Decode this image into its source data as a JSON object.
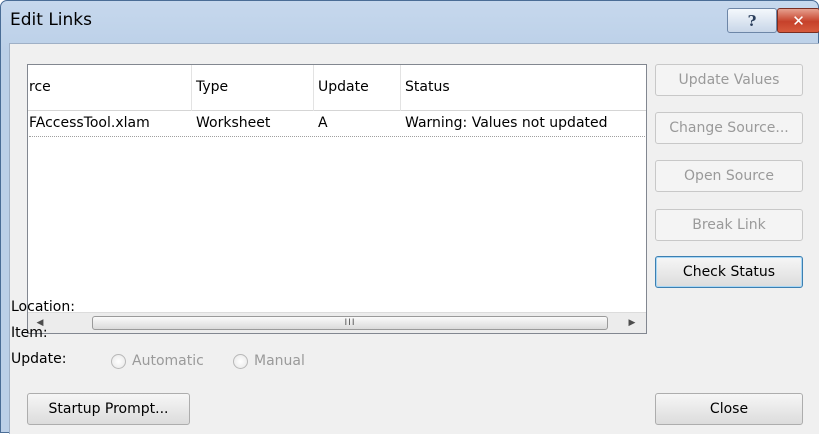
{
  "window": {
    "title": "Edit Links",
    "help_label": "?",
    "close_glyph": "✕"
  },
  "list": {
    "columns": [
      "rce",
      "Type",
      "Update",
      "Status"
    ],
    "rows": [
      {
        "source": "FAccessTool.xlam",
        "type": "Worksheet",
        "update": "A",
        "status": "Warning: Values not updated"
      }
    ],
    "scroll": {
      "left_arrow": "◀",
      "right_arrow": "▶",
      "thumb_grip": "III"
    }
  },
  "buttons": {
    "update_values": "Update Values",
    "change_source": "Change Source...",
    "open_source": "Open Source",
    "break_link": "Break Link",
    "check_status": "Check Status",
    "startup_prompt": "Startup Prompt...",
    "close": "Close"
  },
  "details": {
    "location_label": "Location:",
    "item_label": "Item:",
    "update_label": "Update:",
    "automatic_label": "Automatic",
    "manual_label": "Manual"
  }
}
